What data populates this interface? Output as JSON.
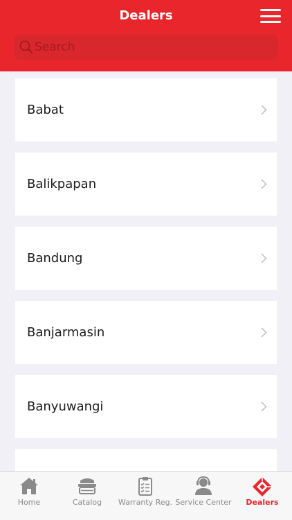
{
  "header": {
    "title": "Dealers"
  },
  "search": {
    "placeholder": "Search"
  },
  "dealers": [
    "Babat",
    "Balikpapan",
    "Bandung",
    "Banjarmasin",
    "Banyuwangi",
    ""
  ],
  "tabs": [
    {
      "label": "Home",
      "icon": "home-icon"
    },
    {
      "label": "Catalog",
      "icon": "catalog-icon"
    },
    {
      "label": "Warranty Reg.",
      "icon": "clipboard-icon"
    },
    {
      "label": "Service Center",
      "icon": "headset-person-icon"
    },
    {
      "label": "Dealers",
      "icon": "dealer-diamond-icon"
    }
  ],
  "colors": {
    "brand": "#e8262b",
    "background": "#f1f0f6",
    "tab_inactive": "#8a8a8a"
  }
}
